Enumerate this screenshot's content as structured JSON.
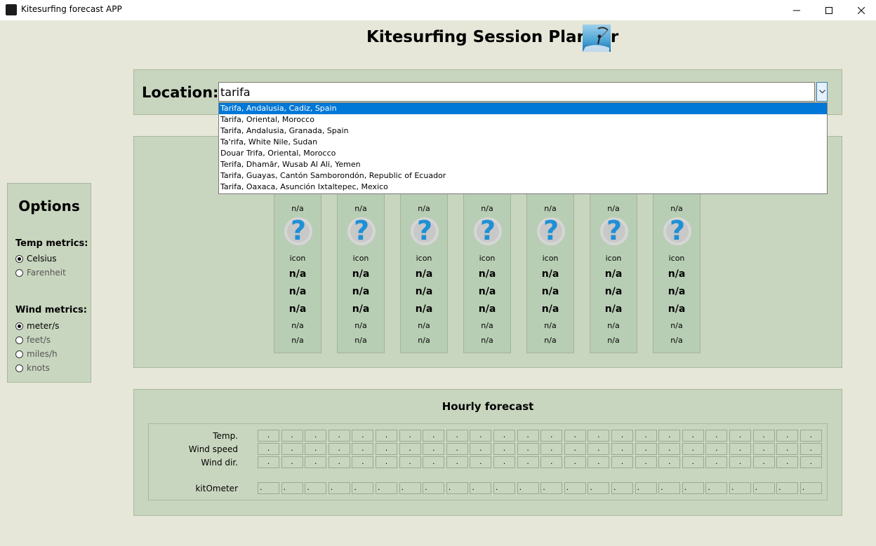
{
  "window": {
    "title": "Kitesurfing forecast APP"
  },
  "heading": "Kitesurfing Session Planner",
  "location": {
    "label": "Location:",
    "value": "tarifa",
    "suggestions": [
      "Tarifa, Andalusia, Cadiz, Spain",
      "Tarifa, Oriental, Morocco",
      "Tarifa, Andalusia, Granada, Spain",
      "Ta'rifa, White Nile, Sudan",
      "Douar Trifa, Oriental, Morocco",
      "Terifa, Dhamār, Wusab Al Ali, Yemen",
      "Tarifa, Guayas, Cantón Samborondón, Republic of Ecuador",
      "Tarifa, Oaxaca, Asunción Ixtaltepec, Mexico"
    ],
    "selected_index": 0
  },
  "days": [
    {
      "top": "n/a",
      "icon_label": "icon",
      "v1": "n/a",
      "v2": "n/a",
      "v3": "n/a",
      "v4": "n/a",
      "v5": "n/a"
    },
    {
      "top": "n/a",
      "icon_label": "icon",
      "v1": "n/a",
      "v2": "n/a",
      "v3": "n/a",
      "v4": "n/a",
      "v5": "n/a"
    },
    {
      "top": "n/a",
      "icon_label": "icon",
      "v1": "n/a",
      "v2": "n/a",
      "v3": "n/a",
      "v4": "n/a",
      "v5": "n/a"
    },
    {
      "top": "n/a",
      "icon_label": "icon",
      "v1": "n/a",
      "v2": "n/a",
      "v3": "n/a",
      "v4": "n/a",
      "v5": "n/a"
    },
    {
      "top": "n/a",
      "icon_label": "icon",
      "v1": "n/a",
      "v2": "n/a",
      "v3": "n/a",
      "v4": "n/a",
      "v5": "n/a"
    },
    {
      "top": "n/a",
      "icon_label": "icon",
      "v1": "n/a",
      "v2": "n/a",
      "v3": "n/a",
      "v4": "n/a",
      "v5": "n/a"
    },
    {
      "top": "n/a",
      "icon_label": "icon",
      "v1": "n/a",
      "v2": "n/a",
      "v3": "n/a",
      "v4": "n/a",
      "v5": "n/a"
    }
  ],
  "options": {
    "title": "Options",
    "temp_label": "Temp metrics:",
    "temp_choices": [
      "Celsius",
      "Farenheit"
    ],
    "temp_selected": 0,
    "wind_label": "Wind metrics:",
    "wind_choices": [
      "meter/s",
      "feet/s",
      "miles/h",
      "knots"
    ],
    "wind_selected": 0
  },
  "hourly": {
    "title": "Hourly forecast",
    "rows": [
      "Temp.",
      "Wind speed",
      "Wind dir.",
      "kitOmeter"
    ],
    "cell_value": "."
  },
  "colors": {
    "background": "#e6e7d8",
    "panel": "#c9d6bf",
    "day_column": "#b8ceb4",
    "selection": "#0078d7",
    "question_icon": "#1e90d6"
  }
}
